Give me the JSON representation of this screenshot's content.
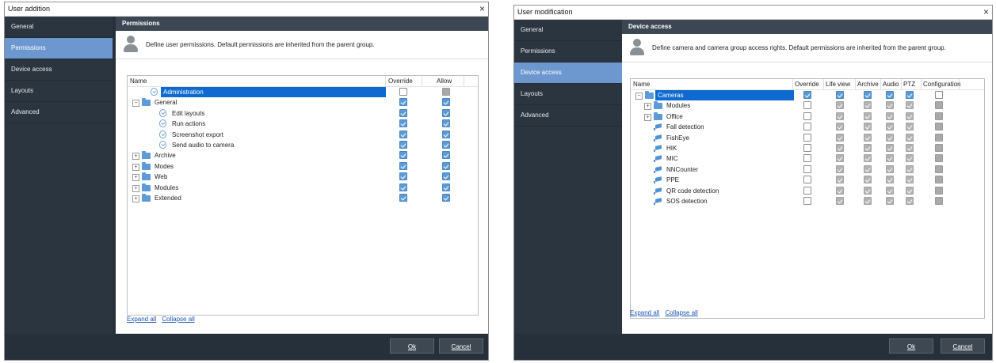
{
  "left": {
    "title": "User addition",
    "close": "×",
    "sidebar": [
      {
        "label": "General"
      },
      {
        "label": "Permissions"
      },
      {
        "label": "Device access"
      },
      {
        "label": "Layouts"
      },
      {
        "label": "Advanced"
      }
    ],
    "active": 1,
    "section_title": "Permissions",
    "description": "Define user permissions. Default permissions are inherited from the parent group.",
    "columns": {
      "name": "Name",
      "override": "Override",
      "allow": "Allow"
    },
    "rows": [
      {
        "name": "Administration",
        "level": 1,
        "icon": "shield-icon",
        "toggle": "",
        "selected": true,
        "cells": [
          "empty",
          "gray-fill"
        ]
      },
      {
        "name": "General",
        "level": 0,
        "icon": "folder-icon",
        "toggle": "−",
        "cells": [
          "blue-check",
          "blue-check"
        ]
      },
      {
        "name": "Edit layouts",
        "level": 2,
        "icon": "shield-icon",
        "toggle": "",
        "cells": [
          "blue-check",
          "blue-check"
        ]
      },
      {
        "name": "Run actions",
        "level": 2,
        "icon": "shield-icon",
        "toggle": "",
        "cells": [
          "blue-check",
          "blue-check"
        ]
      },
      {
        "name": "Screenshot export",
        "level": 2,
        "icon": "shield-icon",
        "toggle": "",
        "cells": [
          "blue-check",
          "blue-check"
        ]
      },
      {
        "name": "Send audio to camera",
        "level": 2,
        "icon": "shield-icon",
        "toggle": "",
        "cells": [
          "blue-check",
          "blue-check"
        ]
      },
      {
        "name": "Archive",
        "level": 0,
        "icon": "folder-icon",
        "toggle": "+",
        "cells": [
          "blue-check",
          "blue-check"
        ]
      },
      {
        "name": "Modes",
        "level": 0,
        "icon": "folder-icon",
        "toggle": "+",
        "cells": [
          "blue-check",
          "blue-check"
        ]
      },
      {
        "name": "Web",
        "level": 0,
        "icon": "folder-icon",
        "toggle": "+",
        "cells": [
          "blue-check",
          "blue-check"
        ]
      },
      {
        "name": "Modules",
        "level": 0,
        "icon": "folder-icon",
        "toggle": "+",
        "cells": [
          "blue-check",
          "blue-check"
        ]
      },
      {
        "name": "Extended",
        "level": 0,
        "icon": "folder-icon",
        "toggle": "+",
        "cells": [
          "blue-check",
          "blue-check"
        ]
      }
    ],
    "expand_all": "Expand all",
    "collapse_all": "Collapse all",
    "ok": "Ok",
    "cancel": "Cancel"
  },
  "right": {
    "title": "User modification",
    "close": "×",
    "sidebar": [
      {
        "label": "General"
      },
      {
        "label": "Permissions"
      },
      {
        "label": "Device access"
      },
      {
        "label": "Layouts"
      },
      {
        "label": "Advanced"
      }
    ],
    "active": 2,
    "section_title": "Device access",
    "description": "Define camera and camera group access rights. Default permissions are inherited from the parent group.",
    "columns": {
      "name": "Name",
      "override": "Override",
      "live": "Life view",
      "archive": "Archive",
      "audio": "Audio",
      "ptz": "PTZ",
      "config": "Configuration"
    },
    "rows": [
      {
        "name": "Cameras",
        "level": 0,
        "icon": "folder-icon",
        "toggle": "−",
        "selected": true,
        "cells": [
          "blue-check",
          "blue-check",
          "blue-check",
          "blue-check",
          "blue-check",
          "empty"
        ]
      },
      {
        "name": "Modules",
        "level": 1,
        "icon": "folder-icon",
        "toggle": "+",
        "cells": [
          "empty",
          "gray-check",
          "gray-check",
          "gray-check",
          "gray-check",
          "gray-fill"
        ]
      },
      {
        "name": "Office",
        "level": 1,
        "icon": "folder-icon",
        "toggle": "+",
        "cells": [
          "empty",
          "gray-check",
          "gray-check",
          "gray-check",
          "gray-check",
          "gray-fill"
        ]
      },
      {
        "name": "Fall detection",
        "level": 1,
        "icon": "camera-icon",
        "toggle": "",
        "cells": [
          "empty",
          "gray-check",
          "gray-check",
          "gray-check",
          "gray-check",
          "gray-fill"
        ]
      },
      {
        "name": "FishEye",
        "level": 1,
        "icon": "camera-icon",
        "toggle": "",
        "cells": [
          "empty",
          "gray-check",
          "gray-check",
          "gray-check",
          "gray-check",
          "gray-fill"
        ]
      },
      {
        "name": "HIK",
        "level": 1,
        "icon": "camera-icon",
        "toggle": "",
        "cells": [
          "empty",
          "gray-check",
          "gray-check",
          "gray-check",
          "gray-check",
          "gray-fill"
        ]
      },
      {
        "name": "MIC",
        "level": 1,
        "icon": "camera-icon",
        "toggle": "",
        "cells": [
          "empty",
          "gray-check",
          "gray-check",
          "gray-check",
          "gray-check",
          "gray-fill"
        ]
      },
      {
        "name": "NNCounter",
        "level": 1,
        "icon": "camera-icon",
        "toggle": "",
        "cells": [
          "empty",
          "gray-check",
          "gray-check",
          "gray-check",
          "gray-check",
          "gray-fill"
        ]
      },
      {
        "name": "PPE",
        "level": 1,
        "icon": "camera-icon",
        "toggle": "",
        "cells": [
          "empty",
          "gray-check",
          "gray-check",
          "gray-check",
          "gray-check",
          "gray-fill"
        ]
      },
      {
        "name": "QR code detection",
        "level": 1,
        "icon": "camera-icon",
        "toggle": "",
        "cells": [
          "empty",
          "gray-check",
          "gray-check",
          "gray-check",
          "gray-check",
          "gray-fill"
        ]
      },
      {
        "name": "SOS detection",
        "level": 1,
        "icon": "camera-icon",
        "toggle": "",
        "cells": [
          "empty",
          "gray-check",
          "gray-check",
          "gray-check",
          "gray-check",
          "gray-fill"
        ]
      }
    ],
    "expand_all": "Expand all",
    "collapse_all": "Collapse all",
    "ok": "Ok",
    "cancel": "Cancel"
  },
  "colors": {
    "sidebar_active": "#6d98cf",
    "selection": "#0f6ad0",
    "check_blue": "#5c9bd6",
    "dialog_dark": "#26303a",
    "header_bar": "#3c4753"
  }
}
